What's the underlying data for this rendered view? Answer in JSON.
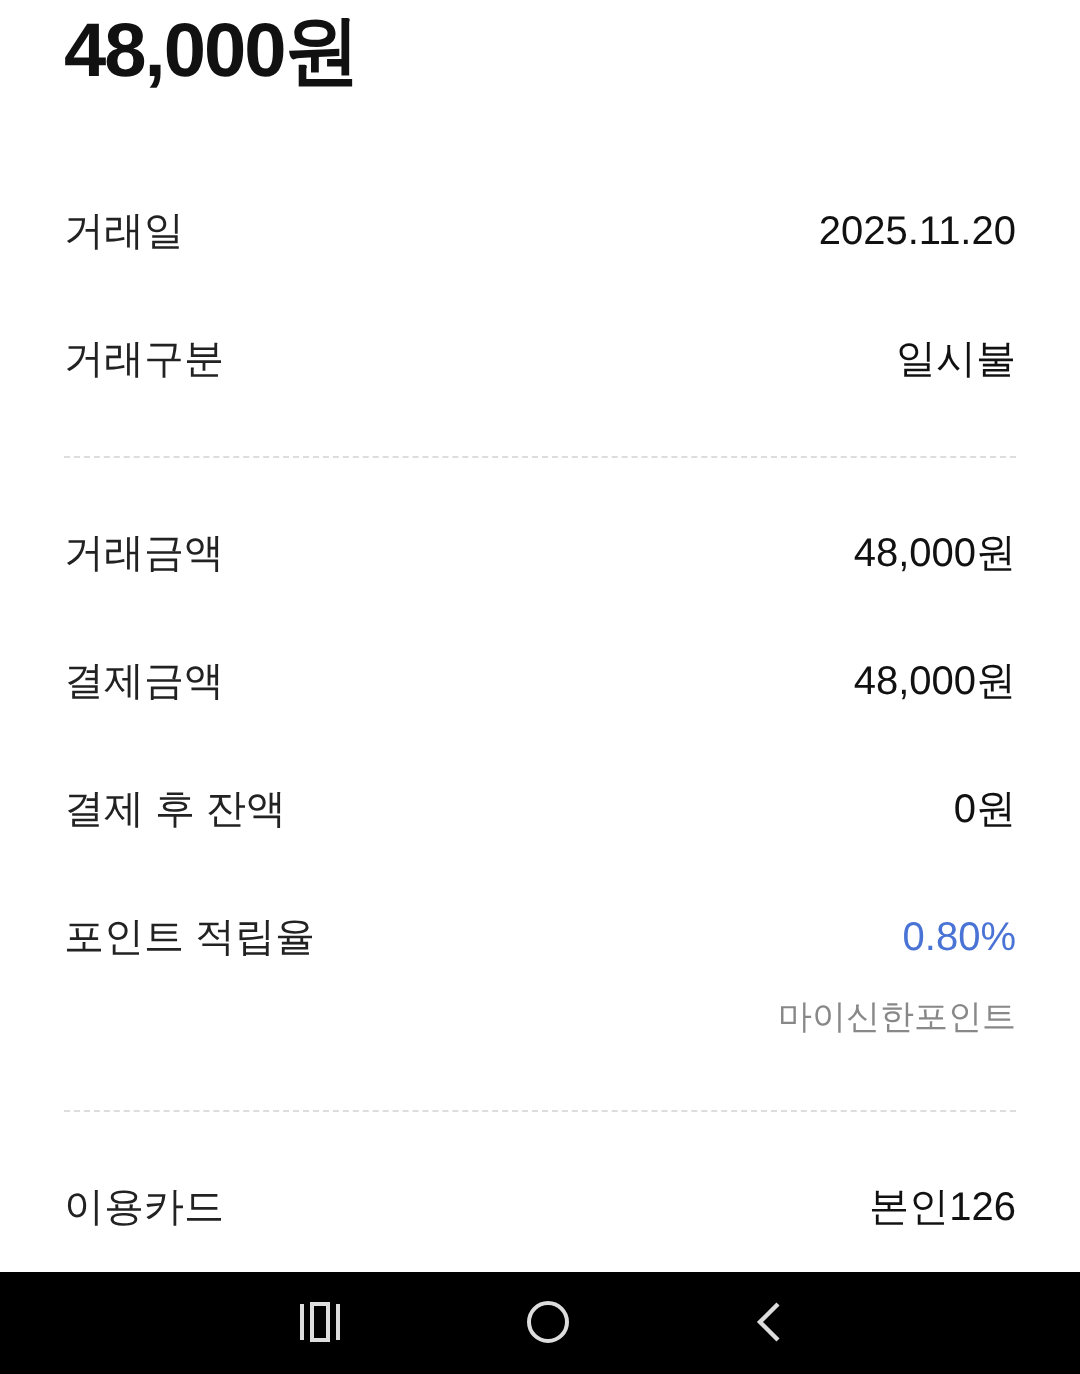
{
  "amount": "48,000원",
  "sections": [
    {
      "rows": [
        {
          "label": "거래일",
          "value": "2025.11.20",
          "kind": "plain"
        },
        {
          "label": "거래구분",
          "value": "일시불",
          "kind": "plain"
        }
      ]
    },
    {
      "rows": [
        {
          "label": "거래금액",
          "value": "48,000원",
          "kind": "plain"
        },
        {
          "label": "결제금액",
          "value": "48,000원",
          "kind": "plain"
        },
        {
          "label": "결제 후 잔액",
          "value": "0원",
          "kind": "plain"
        },
        {
          "label": "포인트 적립율",
          "value": "0.80%",
          "kind": "highlight",
          "note": "마이신한포인트"
        }
      ]
    },
    {
      "rows": [
        {
          "label": "이용카드",
          "value": "본인126",
          "kind": "plain"
        }
      ]
    }
  ]
}
